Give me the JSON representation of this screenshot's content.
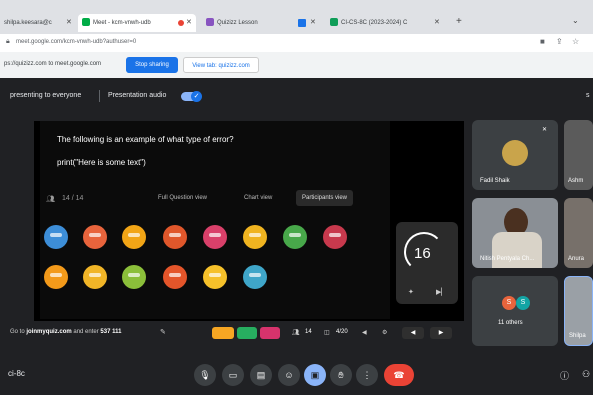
{
  "tabs": [
    {
      "label": "shilpa.keesara@c"
    },
    {
      "label": "Meet - kcm-vnwh-udb"
    },
    {
      "label": "Quizizz Lesson"
    },
    {
      "label": "CI-CS-8C (2023-2024) C"
    }
  ],
  "new_tab_symbol": "+",
  "url": "meet.google.com/kcm-vnwh-udb?authuser=0",
  "sharing": {
    "text": "ps://quizizz.com to meet.google.com",
    "stop_label": "Stop sharing",
    "view_label": "View tab: quizizz.com"
  },
  "presentation": {
    "presenting_text": "presenting to everyone",
    "audio_label": "Presentation audio",
    "right_glyph": "s"
  },
  "quiz": {
    "question": "The following is an example of what type of error?",
    "code": "print(\"Here is some text\")",
    "progress": "14 / 14",
    "tab_full": "Full Question view",
    "tab_chart": "Chart view",
    "tab_participants": "Participants view",
    "timer": "16",
    "join_prefix": "Go to",
    "join_site": "joinmyquiz.com",
    "join_mid": "and enter",
    "join_code": "537 111",
    "players": "14",
    "question_count": "4/20"
  },
  "participants": [
    {
      "name": "Fadil Shaik"
    },
    {
      "name": "Ashm"
    },
    {
      "name": "Nitish Pentyala Ch..."
    },
    {
      "name": "Anura"
    },
    {
      "name": "11 others"
    },
    {
      "name": "Shilpa"
    }
  ],
  "others_avatars": [
    "S",
    "S"
  ],
  "meeting_code": "ci-8c",
  "colors": {
    "accent": "#1a73e8",
    "meet_bg": "#202124",
    "end_call": "#ea4335",
    "quiz_purple": "#8854c0"
  }
}
